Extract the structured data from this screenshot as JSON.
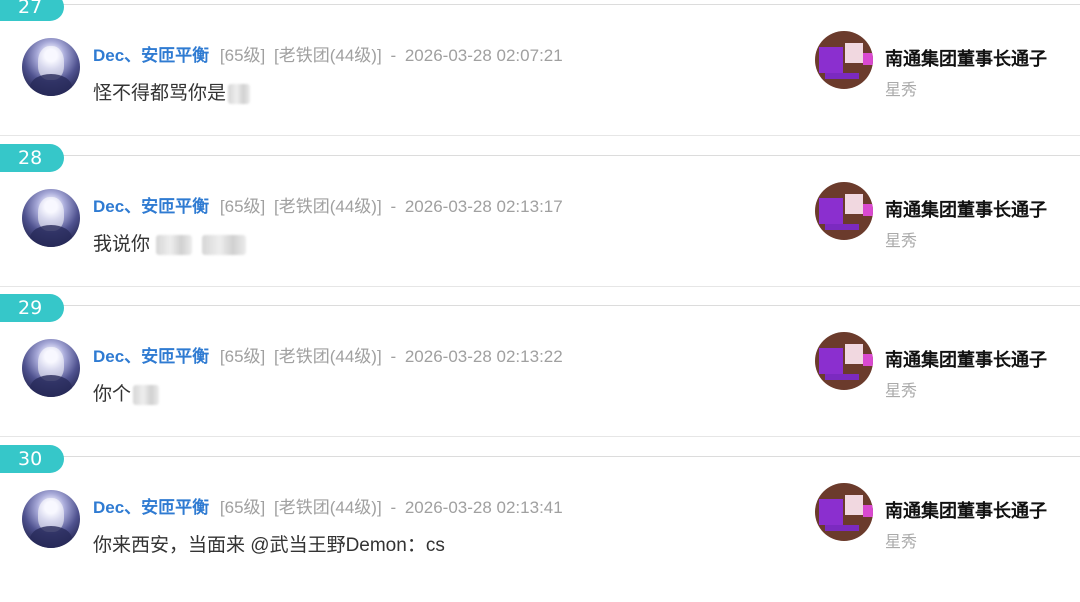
{
  "comments": [
    {
      "floor": "27",
      "username": "Dec、安匝平衡",
      "level": "[65级]",
      "group": "[老铁团(44级)]",
      "separator": "-",
      "timestamp": "2026-03-28 02:07:21",
      "message_text": "怪不得都骂你是",
      "message_tail": "",
      "gift_sender": "南通集团董事长通子",
      "gift_type": "星秀"
    },
    {
      "floor": "28",
      "username": "Dec、安匝平衡",
      "level": "[65级]",
      "group": "[老铁团(44级)]",
      "separator": "-",
      "timestamp": "2026-03-28 02:13:17",
      "message_text": "我说你",
      "message_tail": "",
      "gift_sender": "南通集团董事长通子",
      "gift_type": "星秀"
    },
    {
      "floor": "29",
      "username": "Dec、安匝平衡",
      "level": "[65级]",
      "group": "[老铁团(44级)]",
      "separator": "-",
      "timestamp": "2026-03-28 02:13:22",
      "message_text": "你个",
      "message_tail": "",
      "gift_sender": "南通集团董事长通子",
      "gift_type": "星秀"
    },
    {
      "floor": "30",
      "username": "Dec、安匝平衡",
      "level": "[65级]",
      "group": "[老铁团(44级)]",
      "separator": "-",
      "timestamp": "2026-03-28 02:13:41",
      "message_text": "你来西安，当面来 @武当王野Demon：cs",
      "message_tail": "",
      "gift_sender": "南通集团董事长通子",
      "gift_type": "星秀"
    }
  ],
  "colors": {
    "badge": "#36c7c9",
    "username": "#2f7bd2",
    "meta": "#a0a0a0"
  }
}
